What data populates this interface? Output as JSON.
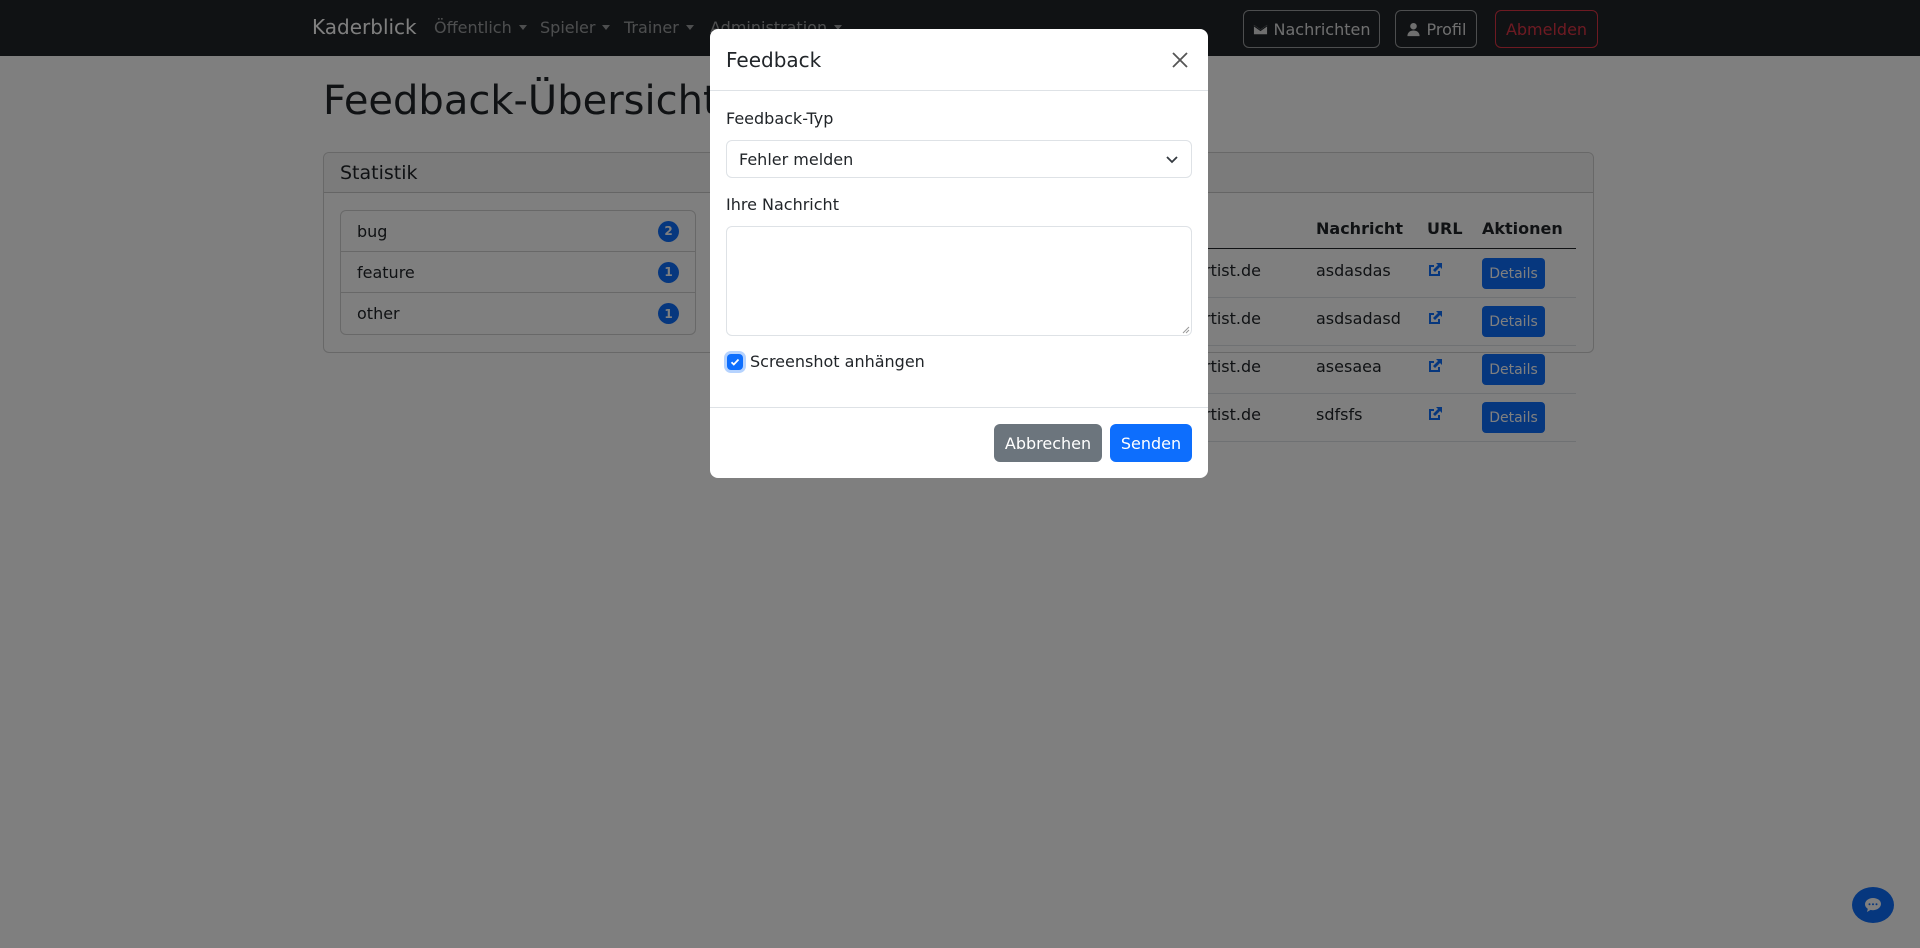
{
  "navbar": {
    "brand": "Kaderblick",
    "menus": [
      "Öffentlich",
      "Spieler",
      "Trainer",
      "Administration"
    ],
    "messages_label": "Nachrichten",
    "profile_label": "Profil",
    "logout_label": "Abmelden"
  },
  "page": {
    "title": "Feedback-Übersicht",
    "stats_header": "Statistik",
    "stats": [
      {
        "label": "bug",
        "count": "2"
      },
      {
        "label": "feature",
        "count": "1"
      },
      {
        "label": "other",
        "count": "1"
      }
    ],
    "table": {
      "headers": {
        "message": "Nachricht",
        "url": "URL",
        "actions": "Aktionen"
      },
      "rows": [
        {
          "user": "rtist.de",
          "message": "asdasdas",
          "action": "Details"
        },
        {
          "user": "rtist.de",
          "message": "asdsadasd",
          "action": "Details"
        },
        {
          "user": "rtist.de",
          "message": "asesaea",
          "action": "Details"
        },
        {
          "user": "rtist.de",
          "message": "sdfsfs",
          "action": "Details"
        }
      ]
    }
  },
  "modal": {
    "title": "Feedback",
    "type_label": "Feedback-Typ",
    "type_value": "Fehler melden",
    "message_label": "Ihre Nachricht",
    "message_value": "",
    "screenshot_label": "Screenshot anhängen",
    "screenshot_checked": true,
    "cancel_label": "Abbrechen",
    "submit_label": "Senden"
  },
  "colors": {
    "primary": "#0d6efd",
    "secondary": "#6c757d",
    "danger": "#dc3545",
    "navbar": "#212529"
  }
}
